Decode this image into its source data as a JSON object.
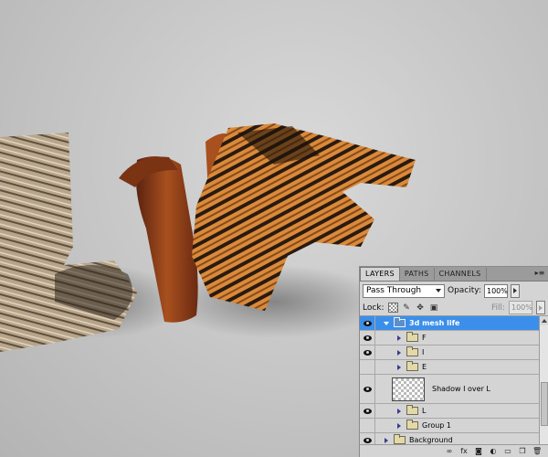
{
  "panel": {
    "tabs": [
      {
        "label": "LAYERS",
        "active": true
      },
      {
        "label": "PATHS",
        "active": false
      },
      {
        "label": "CHANNELS",
        "active": false
      }
    ],
    "menu_icon": "panel-menu-icon",
    "blend_mode": "Pass Through",
    "opacity_label": "Opacity:",
    "opacity_value": "100%",
    "lock_label": "Lock:",
    "fill_label": "Fill:",
    "fill_value": "100%",
    "layers": [
      {
        "name": "3d mesh life",
        "type": "group",
        "visible": true,
        "expanded": true,
        "selected": true,
        "level": 0
      },
      {
        "name": "F",
        "type": "group",
        "visible": true,
        "expanded": false,
        "selected": false,
        "level": 1
      },
      {
        "name": "I",
        "type": "group",
        "visible": true,
        "expanded": false,
        "selected": false,
        "level": 1
      },
      {
        "name": "E",
        "type": "group",
        "visible": false,
        "expanded": false,
        "selected": false,
        "level": 1
      },
      {
        "name": "Shadow I over L",
        "type": "layer",
        "visible": true,
        "selected": false,
        "level": 1
      },
      {
        "name": "L",
        "type": "group",
        "visible": true,
        "expanded": false,
        "selected": false,
        "level": 1
      },
      {
        "name": "Group 1",
        "type": "group",
        "visible": false,
        "expanded": false,
        "selected": false,
        "level": 1
      },
      {
        "name": "Background",
        "type": "group",
        "visible": true,
        "expanded": false,
        "selected": false,
        "level": 0
      }
    ],
    "bottom_icons": [
      "link-layers-icon",
      "fx-icon",
      "layer-mask-icon",
      "adjustment-layer-icon",
      "new-group-icon",
      "new-layer-icon",
      "delete-layer-icon"
    ],
    "bottom_glyphs": {
      "fx": "fx"
    }
  },
  "colors": {
    "selection": "#3b8fea",
    "panel_bg": "#d4d4d4",
    "tab_bar": "#9b9b9b"
  }
}
